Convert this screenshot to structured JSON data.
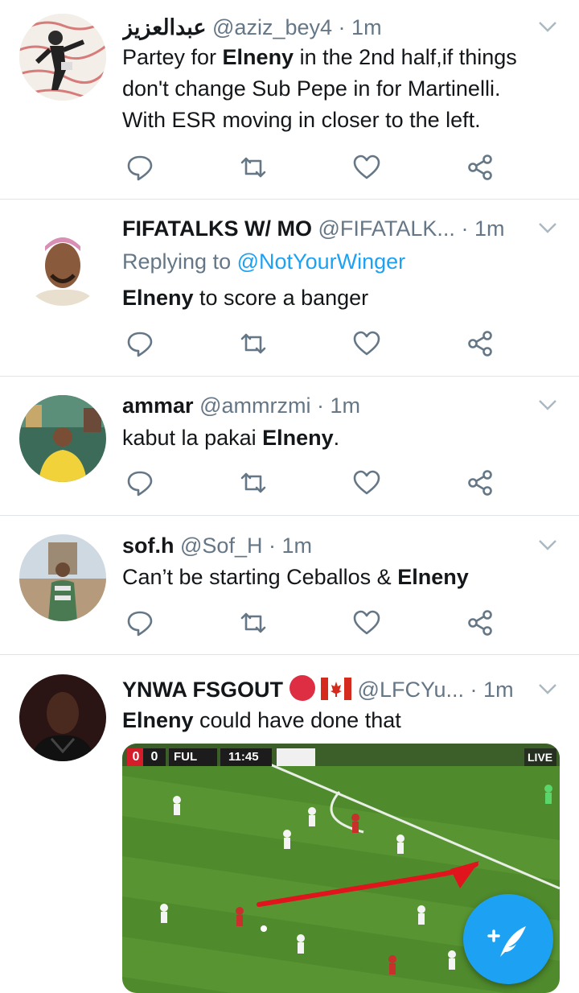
{
  "tweets": [
    {
      "name": "عبدالعزيز",
      "handle": "@aziz_bey4",
      "sep": "·",
      "time": "1m",
      "lines": [
        {
          "parts": [
            {
              "t": "Partey for ",
              "b": false
            },
            {
              "t": "Elneny",
              "b": true
            },
            {
              "t": " in the 2nd half,if things",
              "b": false
            }
          ]
        },
        {
          "parts": [
            {
              "t": "don't change Sub Pepe in for Martinelli.",
              "b": false
            }
          ]
        },
        {
          "parts": [
            {
              "t": "With ESR moving in closer to the left.",
              "b": false
            }
          ]
        }
      ]
    },
    {
      "name": "FIFATALKS W/ MO",
      "handle": "@FIFATALK...",
      "sep": "·",
      "time": "1m",
      "reply_prefix": "Replying to",
      "reply_mention": "@NotYourWinger",
      "lines": [
        {
          "parts": [
            {
              "t": "Elneny",
              "b": true
            },
            {
              "t": " to score a banger",
              "b": false
            }
          ]
        }
      ]
    },
    {
      "name": "ammar",
      "handle": "@ammrzmi",
      "sep": "·",
      "time": "1m",
      "lines": [
        {
          "parts": [
            {
              "t": "kabut la pakai ",
              "b": false
            },
            {
              "t": "Elneny",
              "b": true
            },
            {
              "t": ".",
              "b": false
            }
          ]
        }
      ]
    },
    {
      "name": "sof.h",
      "handle": "@Sof_H",
      "sep": "·",
      "time": "1m",
      "lines": [
        {
          "parts": [
            {
              "t": "Can’t be starting Ceballos & ",
              "b": false
            },
            {
              "t": "Elneny",
              "b": true
            }
          ]
        }
      ]
    },
    {
      "name": "YNWA FSGOUT",
      "handle": "@LFCYu...",
      "sep": "·",
      "time": "1m",
      "lines": [
        {
          "parts": [
            {
              "t": "Elneny",
              "b": true
            },
            {
              "t": " could have done that",
              "b": false
            }
          ]
        }
      ],
      "media": {
        "score_home": "0",
        "score_away": "0",
        "team": "FUL",
        "clock": "11:45",
        "live": "LIVE"
      }
    }
  ],
  "colors": {
    "accent": "#1da1f2",
    "muted": "#657786",
    "divider": "#dfe4e8",
    "pitch": "#4f8a2c"
  },
  "icons": [
    "reply-icon",
    "retweet-icon",
    "like-icon",
    "share-icon",
    "chevron-down-icon",
    "compose-icon"
  ]
}
